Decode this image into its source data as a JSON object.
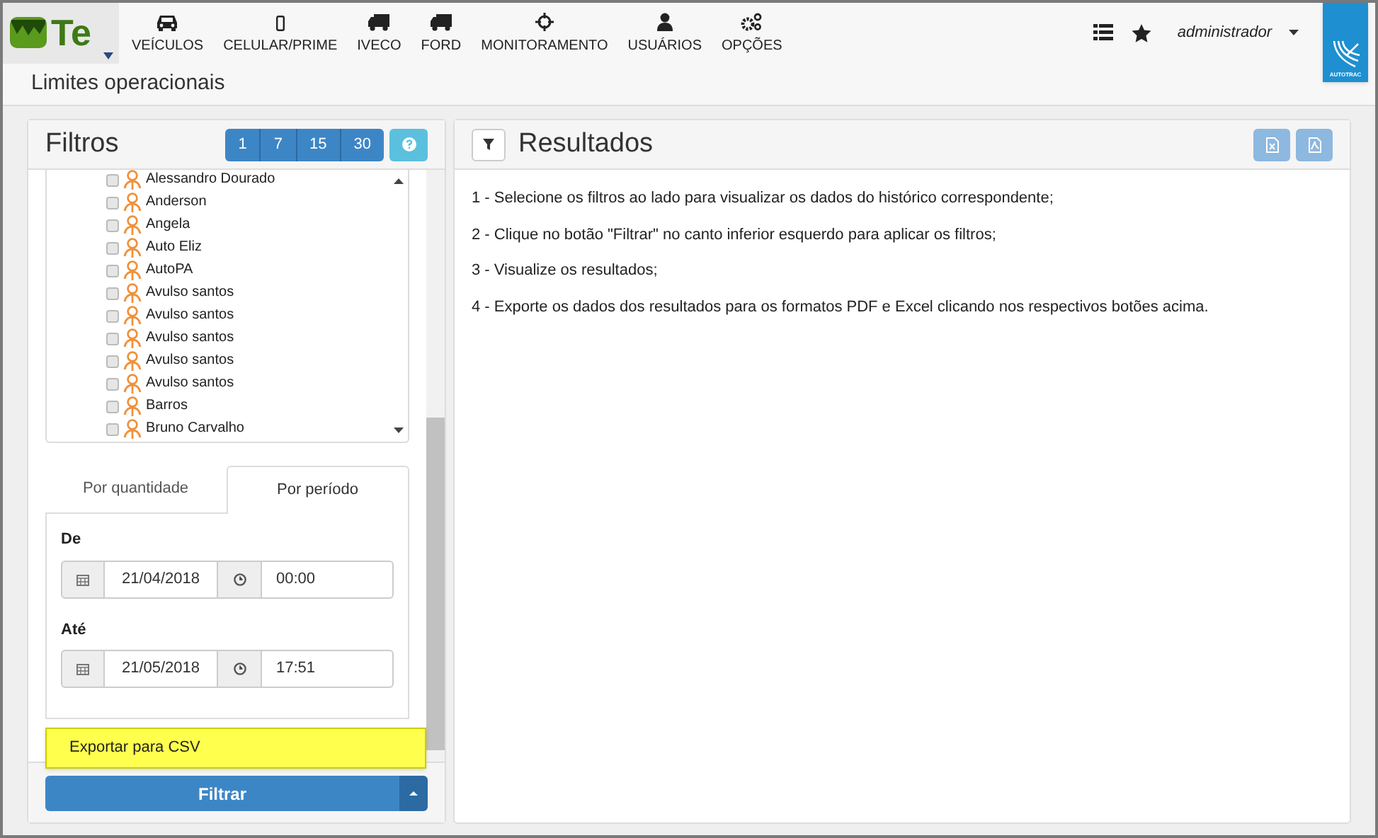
{
  "nav": {
    "logo": "Te",
    "items": [
      {
        "label": "VEÍCULOS"
      },
      {
        "label": "CELULAR/PRIME"
      },
      {
        "label": "IVECO"
      },
      {
        "label": "FORD"
      },
      {
        "label": "MONITORAMENTO"
      },
      {
        "label": "USUÁRIOS"
      },
      {
        "label": "OPÇÕES"
      }
    ],
    "user": "administrador",
    "brand": "AUTOTRAC"
  },
  "page_title": "Limites operacionais",
  "filters": {
    "title": "Filtros",
    "day_buttons": [
      "1",
      "7",
      "15",
      "30"
    ],
    "drivers": [
      {
        "label": "Alessandro Dourado",
        "checked": false
      },
      {
        "label": "Anderson",
        "checked": false
      },
      {
        "label": "Angela",
        "checked": false
      },
      {
        "label": "Auto Eliz",
        "checked": false
      },
      {
        "label": "AutoPA",
        "checked": false
      },
      {
        "label": "Avulso santos",
        "checked": false
      },
      {
        "label": "Avulso santos",
        "checked": false
      },
      {
        "label": "Avulso santos",
        "checked": false
      },
      {
        "label": "Avulso santos",
        "checked": false
      },
      {
        "label": "Avulso santos",
        "checked": false
      },
      {
        "label": "Barros",
        "checked": false
      },
      {
        "label": "Bruno Carvalho",
        "checked": false
      }
    ],
    "tabs": [
      {
        "label": "Por quantidade",
        "selected": false
      },
      {
        "label": "Por período",
        "selected": true
      }
    ],
    "ranges": [
      {
        "label": "De",
        "date": "21/04/2018",
        "time": "00:00"
      },
      {
        "label": "Até",
        "date": "21/05/2018",
        "time": "17:51"
      }
    ],
    "menu_items": [
      "Exportar para CSV"
    ],
    "filter_button": "Filtrar"
  },
  "results": {
    "title": "Resultados",
    "steps": [
      "1 - Selecione os filtros ao lado para visualizar os dados do histórico correspondente;",
      "2 - Clique no botão \"Filtrar\" no canto inferior esquerdo para aplicar os filtros;",
      "3 - Visualize os resultados;",
      "4 - Exporte os dados dos resultados para os formatos PDF e Excel clicando nos respectivos botões acima."
    ]
  }
}
